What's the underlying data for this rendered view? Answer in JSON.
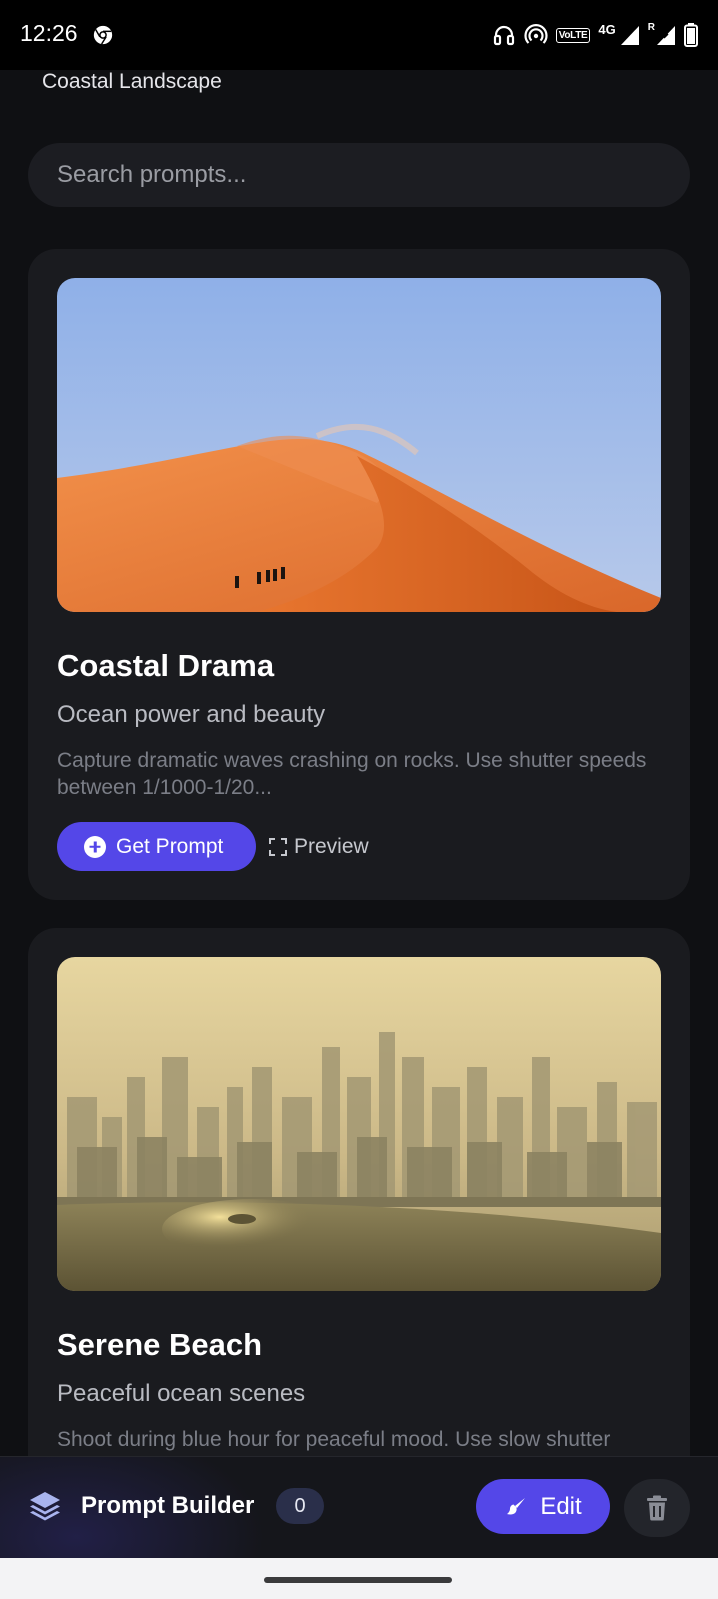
{
  "status_bar": {
    "time": "12:26",
    "icons": [
      "chrome-icon",
      "headphones-icon",
      "hotspot-icon",
      "volte-icon",
      "signal-icon",
      "roaming-signal-icon",
      "battery-icon"
    ],
    "volte_text": "VoLTE",
    "network_text": "4G",
    "roaming_text": "R"
  },
  "header": {
    "context_label": "Coastal Landscape"
  },
  "search": {
    "placeholder": "Search prompts..."
  },
  "cards": [
    {
      "title": "Coastal Drama",
      "subtitle": "Ocean power and beauty",
      "description": "Capture dramatic waves crashing on rocks. Use shutter speeds between 1/1000-1/20...",
      "primary_label": "Get Prompt",
      "secondary_label": "Preview"
    },
    {
      "title": "Serene Beach",
      "subtitle": "Peaceful ocean scenes",
      "description": "Shoot during blue hour for peaceful mood. Use slow shutter"
    }
  ],
  "bottom_bar": {
    "title": "Prompt Builder",
    "count": "0",
    "edit_label": "Edit"
  },
  "colors": {
    "accent": "#5447e8",
    "background": "#0f1013",
    "card": "#1a1b1f"
  }
}
